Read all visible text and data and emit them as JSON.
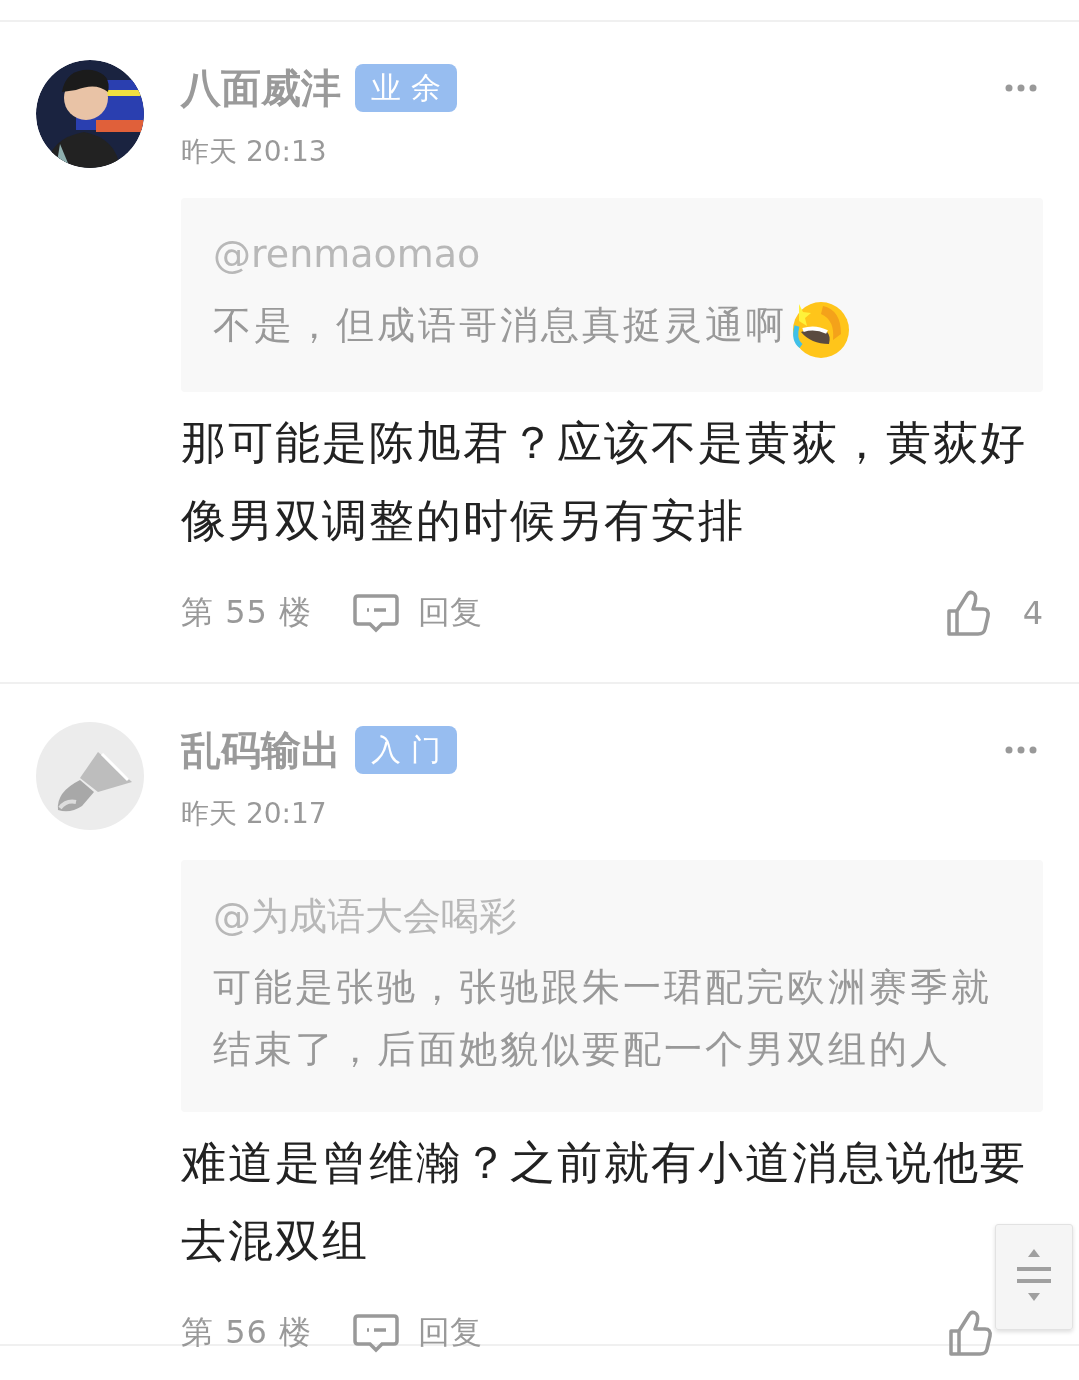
{
  "posts": [
    {
      "name": "八面威沣",
      "badge": "业 余",
      "time": "昨天 20:13",
      "quote": {
        "mention": "@renmaomao",
        "text": "不是，但成语哥消息真挺灵通啊",
        "emoji": true
      },
      "body": "那可能是陈旭君？应该不是黄荻，黄荻好像男双调整的时候另有安排",
      "floor": "第 55 楼",
      "reply": "回复",
      "likes": "4"
    },
    {
      "avatar": {
        "kind": "icon"
      },
      "name": "乱码输出",
      "badge": "入 门",
      "time": "昨天 20:17",
      "quote": {
        "mention": "@为成语大会喝彩",
        "text": "可能是张驰，张驰跟朱一珺配完欧洲赛季就结束了，后面她貌似要配一个男双组的人",
        "emoji": false
      },
      "body": "难道是曾维瀚？之前就有小道消息说他要去混双组",
      "floor": "第 56 楼",
      "reply": "回复"
    }
  ],
  "scroll_button": {
    "kind": "handle"
  }
}
